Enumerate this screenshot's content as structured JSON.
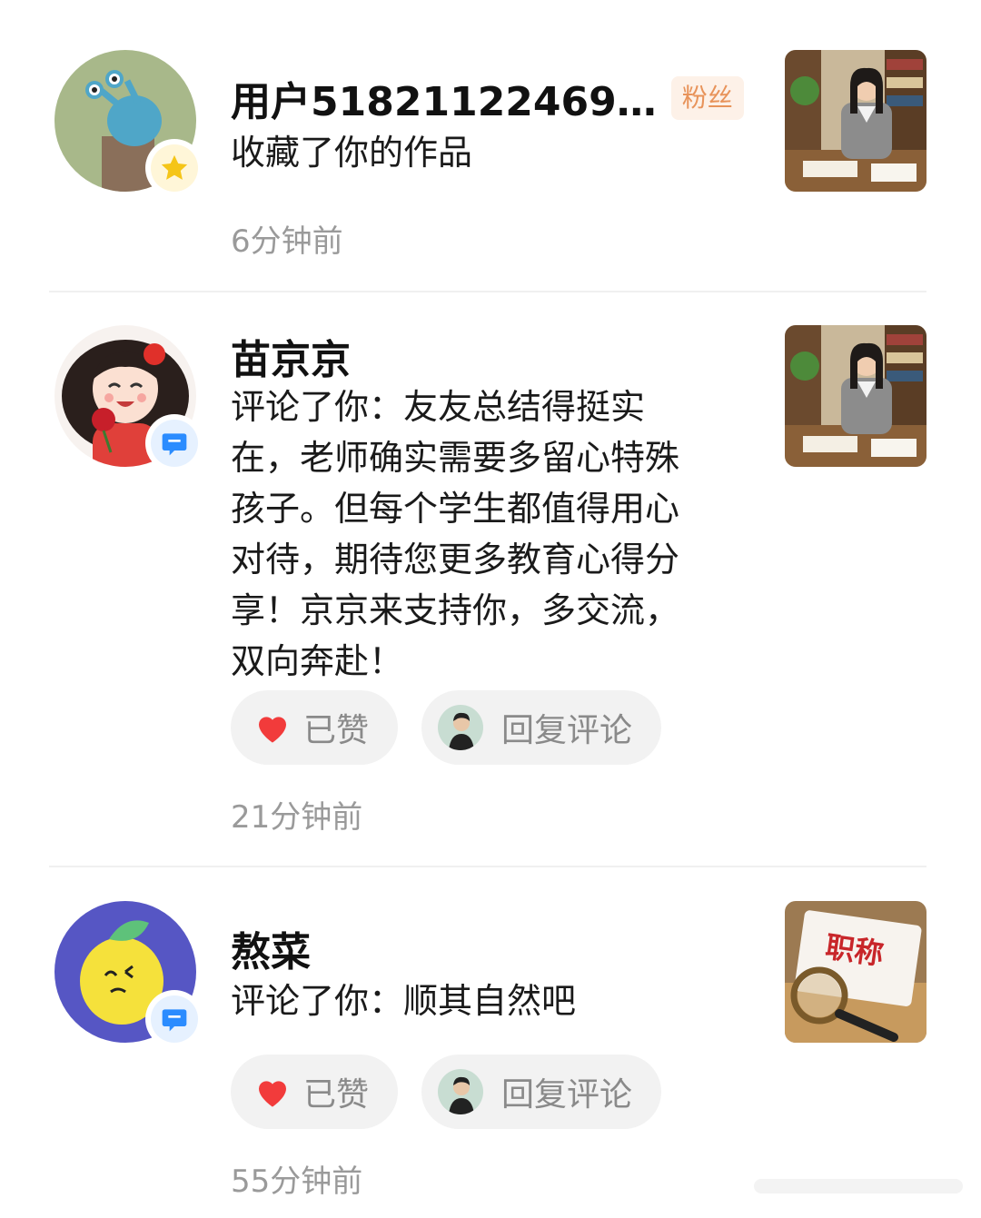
{
  "notifications": [
    {
      "avatar_icon": "snail-avatar",
      "badge_icon": "star-icon",
      "badge_color": "#f5c518",
      "name": "用户51821122469…",
      "fan_badge": "粉丝",
      "action": "收藏了你的作品",
      "time": "6分钟前",
      "thumbnail_icon": "teacher-at-desk-thumbnail"
    },
    {
      "avatar_icon": "girl-with-rose-avatar",
      "badge_icon": "comment-icon",
      "badge_color": "#2b8cff",
      "name": "苗京京",
      "action": "评论了你：友友总结得挺实在，老师确实需要多留心特殊孩子。但每个学生都值得用心对待，期待您更多教育心得分享！京京来支持你，多交流，双向奔赴！",
      "action_lines": [
        "评论了你：友友总结得挺实",
        "在，老师确实需要多留心特殊",
        "孩子。但每个学生都值得用心",
        "对待，期待您更多教育心得分",
        "享！京京来支持你，多交流，",
        "双向奔赴！"
      ],
      "like_label": "已赞",
      "reply_label": "回复评论",
      "time": "21分钟前",
      "thumbnail_icon": "teacher-at-desk-thumbnail"
    },
    {
      "avatar_icon": "lemon-face-avatar",
      "badge_icon": "comment-icon",
      "badge_color": "#2b8cff",
      "name": "熬菜",
      "action": "评论了你：顺其自然吧",
      "like_label": "已赞",
      "reply_label": "回复评论",
      "time": "55分钟前",
      "thumbnail_icon": "magnifier-title-card-thumbnail",
      "thumbnail_text": "职称"
    }
  ],
  "colors": {
    "like_heart": "#f23b3b",
    "fan_badge_bg": "#fdf1e8",
    "fan_badge_text": "#e8935a",
    "meta_text": "#9a9a9a"
  }
}
